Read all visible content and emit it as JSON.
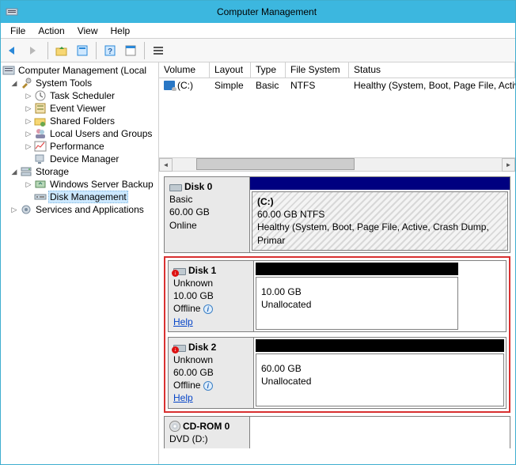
{
  "window": {
    "title": "Computer Management"
  },
  "menubar": {
    "file": "File",
    "action": "Action",
    "view": "View",
    "help": "Help"
  },
  "tree": {
    "root": "Computer Management (Local",
    "system_tools": "System Tools",
    "task_scheduler": "Task Scheduler",
    "event_viewer": "Event Viewer",
    "shared_folders": "Shared Folders",
    "local_users": "Local Users and Groups",
    "performance": "Performance",
    "device_manager": "Device Manager",
    "storage": "Storage",
    "ws_backup": "Windows Server Backup",
    "disk_mgmt": "Disk Management",
    "services_apps": "Services and Applications"
  },
  "vol_cols": {
    "volume": "Volume",
    "layout": "Layout",
    "type": "Type",
    "fs": "File System",
    "status": "Status"
  },
  "vol_row0": {
    "volume": "(C:)",
    "layout": "Simple",
    "type": "Basic",
    "fs": "NTFS",
    "status": "Healthy (System, Boot, Page File, Active, Cra"
  },
  "disk0": {
    "name": "Disk 0",
    "kind": "Basic",
    "size": "60.00 GB",
    "state": "Online",
    "part_label": "(C:)",
    "part_line2": "60.00 GB NTFS",
    "part_line3": "Healthy (System, Boot, Page File, Active, Crash Dump, Primar"
  },
  "disk1": {
    "name": "Disk 1",
    "kind": "Unknown",
    "size": "10.00 GB",
    "state": "Offline",
    "help": "Help",
    "part_line1": "10.00 GB",
    "part_line2": "Unallocated"
  },
  "disk2": {
    "name": "Disk 2",
    "kind": "Unknown",
    "size": "60.00 GB",
    "state": "Offline",
    "help": "Help",
    "part_line1": "60.00 GB",
    "part_line2": "Unallocated"
  },
  "cdrom": {
    "name": "CD-ROM 0",
    "line2": "DVD (D:)"
  }
}
